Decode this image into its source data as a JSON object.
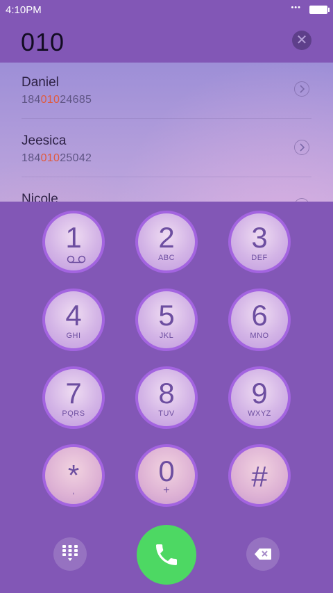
{
  "status_bar": {
    "time": "4:10PM",
    "dots": "•••"
  },
  "dial": {
    "number": "010"
  },
  "results": [
    {
      "name": "Daniel",
      "num_pre": "184",
      "num_match": "010",
      "num_post": "24685"
    },
    {
      "name": "Jeesica",
      "num_pre": "184",
      "num_match": "010",
      "num_post": "25042"
    },
    {
      "name": "Nicole",
      "num_pre": "",
      "num_match": "",
      "num_post": ""
    }
  ],
  "keys": [
    {
      "digit": "1",
      "letters": ""
    },
    {
      "digit": "2",
      "letters": "ABC"
    },
    {
      "digit": "3",
      "letters": "DEF"
    },
    {
      "digit": "4",
      "letters": "GHI"
    },
    {
      "digit": "5",
      "letters": "JKL"
    },
    {
      "digit": "6",
      "letters": "MNO"
    },
    {
      "digit": "7",
      "letters": "PQRS"
    },
    {
      "digit": "8",
      "letters": "TUV"
    },
    {
      "digit": "9",
      "letters": "WXYZ"
    },
    {
      "digit": "*",
      "letters": ","
    },
    {
      "digit": "0",
      "letters": "+"
    },
    {
      "digit": "#",
      "letters": ""
    }
  ],
  "icons": {
    "clear": "close-icon",
    "chevron": "chevron-right-icon",
    "voicemail": "voicemail-icon",
    "dialpad": "dialpad-icon",
    "call": "phone-icon",
    "backspace": "backspace-icon"
  },
  "colors": {
    "accent": "#8257b6",
    "match_highlight": "#e15a3d",
    "call_button": "#4dd863",
    "key_ring": "#a364e0"
  }
}
